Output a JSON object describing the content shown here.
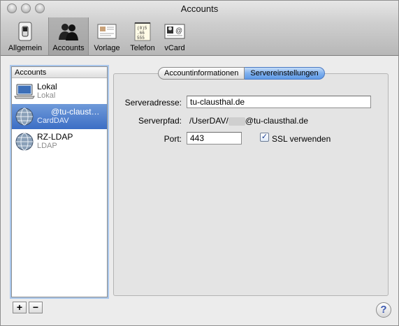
{
  "window": {
    "title": "Accounts"
  },
  "toolbar": {
    "items": [
      {
        "label": "Allgemein",
        "icon": "general-switch-icon"
      },
      {
        "label": "Accounts",
        "icon": "accounts-people-icon"
      },
      {
        "label": "Vorlage",
        "icon": "template-card-icon"
      },
      {
        "label": "Telefon",
        "icon": "phone-notepad-icon"
      },
      {
        "label": "vCard",
        "icon": "vcard-icon"
      }
    ],
    "selected": "Accounts"
  },
  "sidebar": {
    "header": "Accounts",
    "accounts": [
      {
        "name": "Lokal",
        "type": "Lokal",
        "icon": "laptop-icon"
      },
      {
        "name": "@tu-claust…",
        "type": "CardDAV",
        "icon": "network-globe-icon"
      },
      {
        "name": "RZ-LDAP",
        "type": "LDAP",
        "icon": "network-globe-icon"
      }
    ],
    "add_label": "+",
    "remove_label": "−"
  },
  "tabs": [
    {
      "label": "Accountinformationen",
      "active": false
    },
    {
      "label": "Servereinstellungen",
      "active": true
    }
  ],
  "form": {
    "server_address_label": "Serveradresse:",
    "server_address_value": "tu-clausthal.de",
    "server_path_label": "Serverpfad:",
    "server_path_prefix": "/UserDAV/",
    "server_path_suffix": "@tu-clausthal.de",
    "port_label": "Port:",
    "port_value": "443",
    "ssl_label": "SSL verwenden",
    "ssl_checked": true
  },
  "help_label": "?",
  "colors": {
    "selection": "#3c6ec5",
    "tab_active": "#7fb0ee"
  }
}
